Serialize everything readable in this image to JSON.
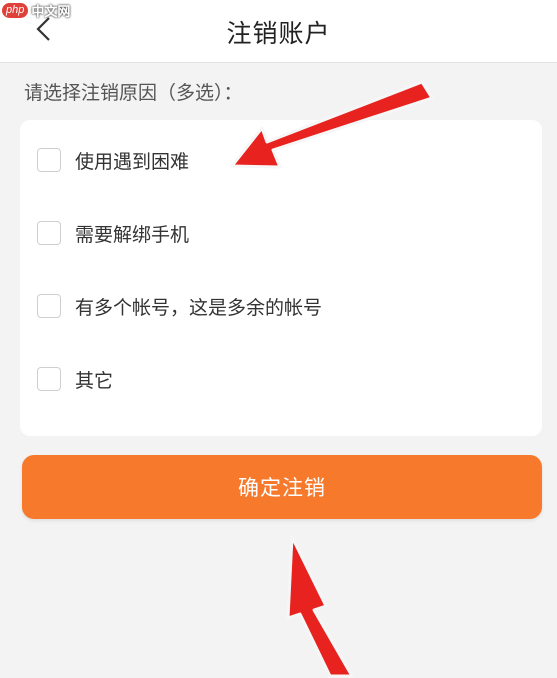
{
  "watermark": {
    "php": "php",
    "site": "中文网"
  },
  "header": {
    "title": "注销账户",
    "back_icon": "chevron-left-icon"
  },
  "prompt": "请选择注销原因（多选）：",
  "options": [
    {
      "label": "使用遇到困难",
      "checked": false
    },
    {
      "label": "需要解绑手机",
      "checked": false
    },
    {
      "label": "有多个帐号，这是多余的帐号",
      "checked": false
    },
    {
      "label": "其它",
      "checked": false
    }
  ],
  "confirm_button": {
    "label": "确定注销"
  },
  "colors": {
    "accent": "#f77a2c",
    "annotation_arrow": "#e8231f",
    "background": "#f3f3f3"
  }
}
